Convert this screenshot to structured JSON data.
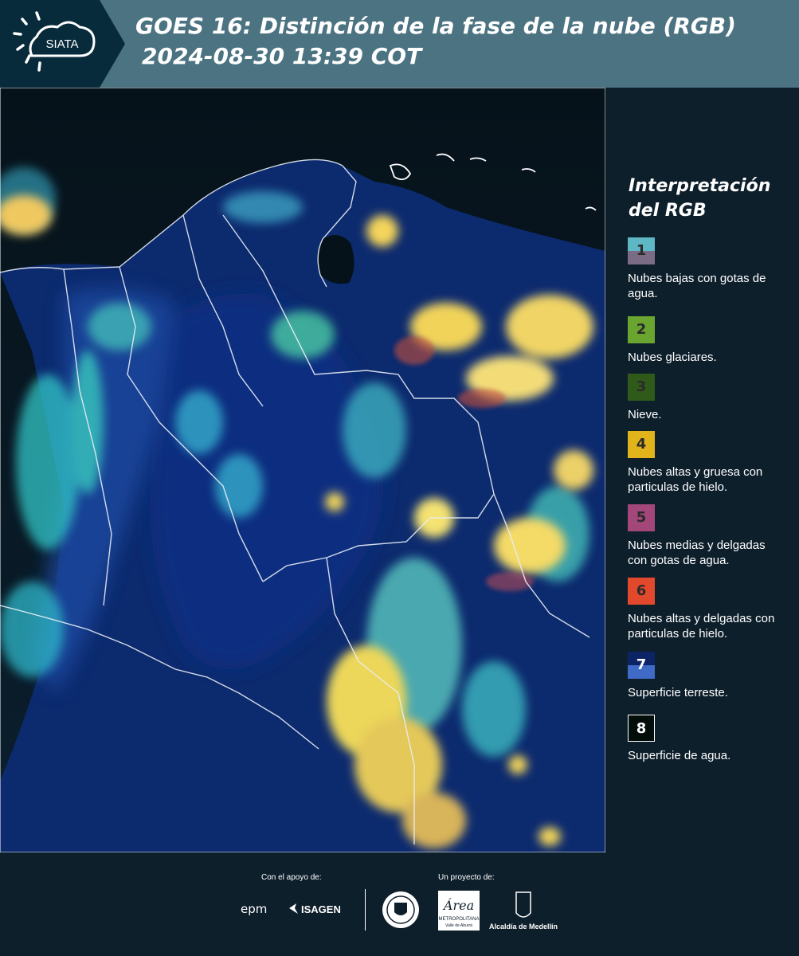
{
  "header": {
    "logo_text": "SIATA",
    "title_line1": "GOES 16: Distinción de la fase de la nube (RGB)",
    "title_line2": "2024-08-30 13:39 COT"
  },
  "legend": {
    "title_line1": "Interpretación",
    "title_line2": "del RGB",
    "items": [
      {
        "number": "1",
        "label": "Nubes bajas con gotas de agua.",
        "color_top": "#5db7c4",
        "color_bottom": "#7a6c84"
      },
      {
        "number": "2",
        "label": "Nubes glaciares.",
        "color_top": "#6aa530",
        "color_bottom": "#6aa530"
      },
      {
        "number": "3",
        "label": "Nieve.",
        "color_top": "#2f5a1a",
        "color_bottom": "#2f5a1a"
      },
      {
        "number": "4",
        "label": "Nubes altas y gruesa con particulas de hielo.",
        "color_top": "#e2b41c",
        "color_bottom": "#e2b41c"
      },
      {
        "number": "5",
        "label": "Nubes medias y delgadas con gotas de agua.",
        "color_top": "#a3477a",
        "color_bottom": "#a3477a"
      },
      {
        "number": "6",
        "label": "Nubes altas y delgadas con particulas de hielo.",
        "color_top": "#e2492c",
        "color_bottom": "#e2492c"
      },
      {
        "number": "7",
        "label": "Superficie terreste.",
        "color_top": "#0c2466",
        "color_bottom": "#3f6bc6"
      },
      {
        "number": "8",
        "label": "Superficie de agua.",
        "color_top": "#030d0a",
        "color_bottom": "#030d0a"
      }
    ]
  },
  "footer": {
    "support_label": "Con el apoyo de:",
    "project_label": "Un proyecto de:",
    "logos": [
      "epm",
      "ISAGEN",
      "METROPOLITANA",
      "Valle de Aburrá",
      "Alcaldía de Medellín"
    ]
  }
}
